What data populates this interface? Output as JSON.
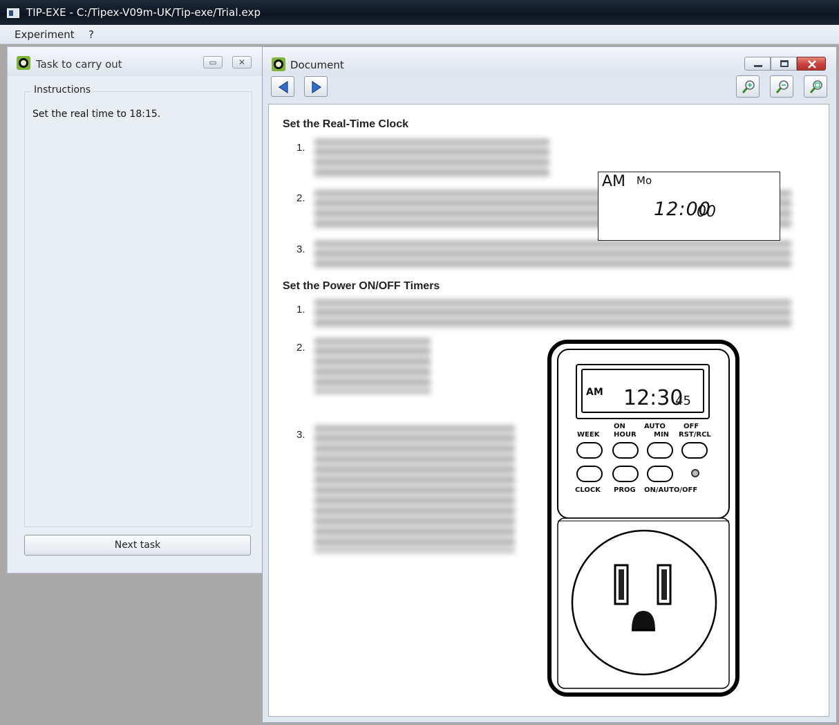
{
  "window": {
    "title": "TIP-EXE - C:/Tipex-V09m-UK/Tip-exe/Trial.exp"
  },
  "menu": [
    "Experiment",
    "?"
  ],
  "task_pane": {
    "title": "Task to carry out",
    "group_label": "Instructions",
    "task_text": "Set the real time to 18:15.",
    "next_button": "Next task",
    "buttons": {
      "restore": "▭",
      "close": "✕"
    }
  },
  "document_pane": {
    "title": "Document",
    "heading_1": "Set the Real-Time Clock",
    "heading_2": "Set the Power ON/OFF Timers",
    "steps_1": [
      "1.",
      "2.",
      "3."
    ],
    "steps_2": [
      "1.",
      "2.",
      "3."
    ],
    "clock_display": {
      "ampm": "AM",
      "day": "Mo",
      "time": "12:00",
      "seconds": "00"
    },
    "device": {
      "display_ampm": "AM",
      "display_time": "12:30",
      "display_seconds": "45",
      "top_labels": [
        "ON",
        "AUTO",
        "OFF"
      ],
      "button_labels": [
        "WEEK",
        "HOUR",
        "MIN",
        "RST/RCL"
      ],
      "bottom_labels": [
        "CLOCK",
        "PROG",
        "ON/AUTO/OFF"
      ]
    }
  },
  "colors": {
    "titlebar": "#0d1520",
    "badge_green": "#7cb53a",
    "close_red": "#c9413a",
    "nav_blue": "#2f6fd0"
  }
}
